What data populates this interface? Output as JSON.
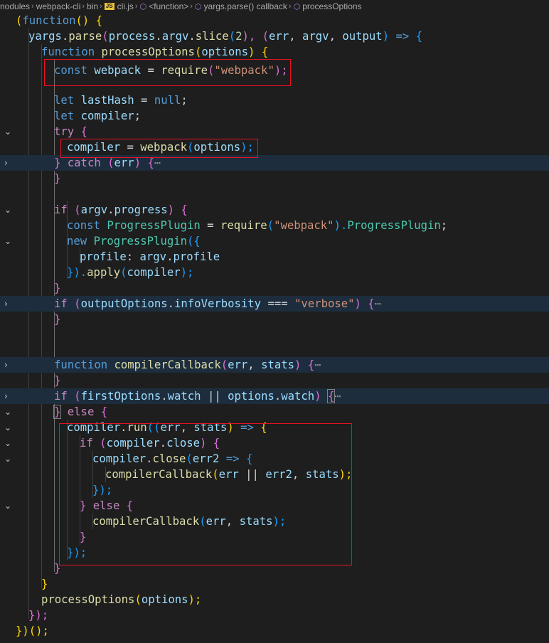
{
  "breadcrumb": {
    "items": [
      "nodules",
      "webpack-cli",
      "bin",
      "cli.js",
      "<function>",
      "yargs.parse() callback",
      "processOptions"
    ],
    "file_badge": "JS"
  },
  "code": {
    "l1": [
      "(",
      "function",
      "() {"
    ],
    "l2": [
      "yargs",
      ".",
      "parse",
      "(",
      "process",
      ".",
      "argv",
      ".",
      "slice",
      "(",
      "2",
      "), (",
      "err",
      ", ",
      "argv",
      ", ",
      "output",
      ") ",
      "=>",
      " {"
    ],
    "l3": [
      "function",
      " ",
      "processOptions",
      "(",
      "options",
      ") {"
    ],
    "l4": [
      "const",
      " ",
      "webpack",
      " = ",
      "require",
      "(",
      "\"webpack\"",
      ");"
    ],
    "l6": [
      "let",
      " ",
      "lastHash",
      " = ",
      "null",
      ";"
    ],
    "l7": [
      "let",
      " ",
      "compiler",
      ";"
    ],
    "l8": [
      "try",
      " {"
    ],
    "l9": [
      "compiler",
      " = ",
      "webpack",
      "(",
      "options",
      ");"
    ],
    "l10": [
      "}",
      " ",
      "catch",
      " (",
      "err",
      ") {",
      "⋯"
    ],
    "l11": [
      "}"
    ],
    "l13": [
      "if",
      " (",
      "argv",
      ".",
      "progress",
      ") {"
    ],
    "l14": [
      "const",
      " ",
      "ProgressPlugin",
      " = ",
      "require",
      "(",
      "\"webpack\"",
      ").",
      "ProgressPlugin",
      ";"
    ],
    "l15": [
      "new",
      " ",
      "ProgressPlugin",
      "({"
    ],
    "l16": [
      "profile",
      ": ",
      "argv",
      ".",
      "profile"
    ],
    "l17": [
      "}).",
      "apply",
      "(",
      "compiler",
      ");"
    ],
    "l18": [
      "}"
    ],
    "l19": [
      "if",
      " (",
      "outputOptions",
      ".",
      "infoVerbosity",
      " === ",
      "\"verbose\"",
      ") {",
      "⋯"
    ],
    "l20": [
      "}"
    ],
    "l22": [
      "function",
      " ",
      "compilerCallback",
      "(",
      "err",
      ", ",
      "stats",
      ") {",
      "⋯"
    ],
    "l23": [
      "}"
    ],
    "l24": [
      "if",
      " (",
      "firstOptions",
      ".",
      "watch",
      " || ",
      "options",
      ".",
      "watch",
      ") ",
      "{",
      "⋯"
    ],
    "l25": [
      "}",
      " ",
      "else",
      " {"
    ],
    "l26": [
      "compiler",
      ".",
      "run",
      "((",
      "err",
      ", ",
      "stats",
      ") ",
      "=>",
      " {"
    ],
    "l27": [
      "if",
      " (",
      "compiler",
      ".",
      "close",
      ") {"
    ],
    "l28": [
      "compiler",
      ".",
      "close",
      "(",
      "err2",
      " ",
      "=>",
      " {"
    ],
    "l29": [
      "compilerCallback",
      "(",
      "err",
      " || ",
      "err2",
      ", ",
      "stats",
      ");"
    ],
    "l30": [
      "});"
    ],
    "l31": [
      "}",
      " ",
      "else",
      " {"
    ],
    "l32": [
      "compilerCallback",
      "(",
      "err",
      ", ",
      "stats",
      ");"
    ],
    "l33": [
      "}"
    ],
    "l34": [
      "});"
    ],
    "l35": [
      "}"
    ],
    "l36": [
      "}"
    ],
    "l37": [
      "processOptions",
      "(",
      "options",
      ");"
    ],
    "l38": [
      "});"
    ],
    "l39": [
      "})();"
    ]
  },
  "copilot_icon": "sparkle-icon",
  "colors": {
    "background": "#1e1e1e",
    "keyword": "#569cd6",
    "control": "#c586c0",
    "function": "#dcdcaa",
    "variable": "#9cdcfe",
    "string": "#ce9178",
    "number": "#b5cea8",
    "class": "#4ec9b0",
    "highlight_box": "#e81123"
  }
}
